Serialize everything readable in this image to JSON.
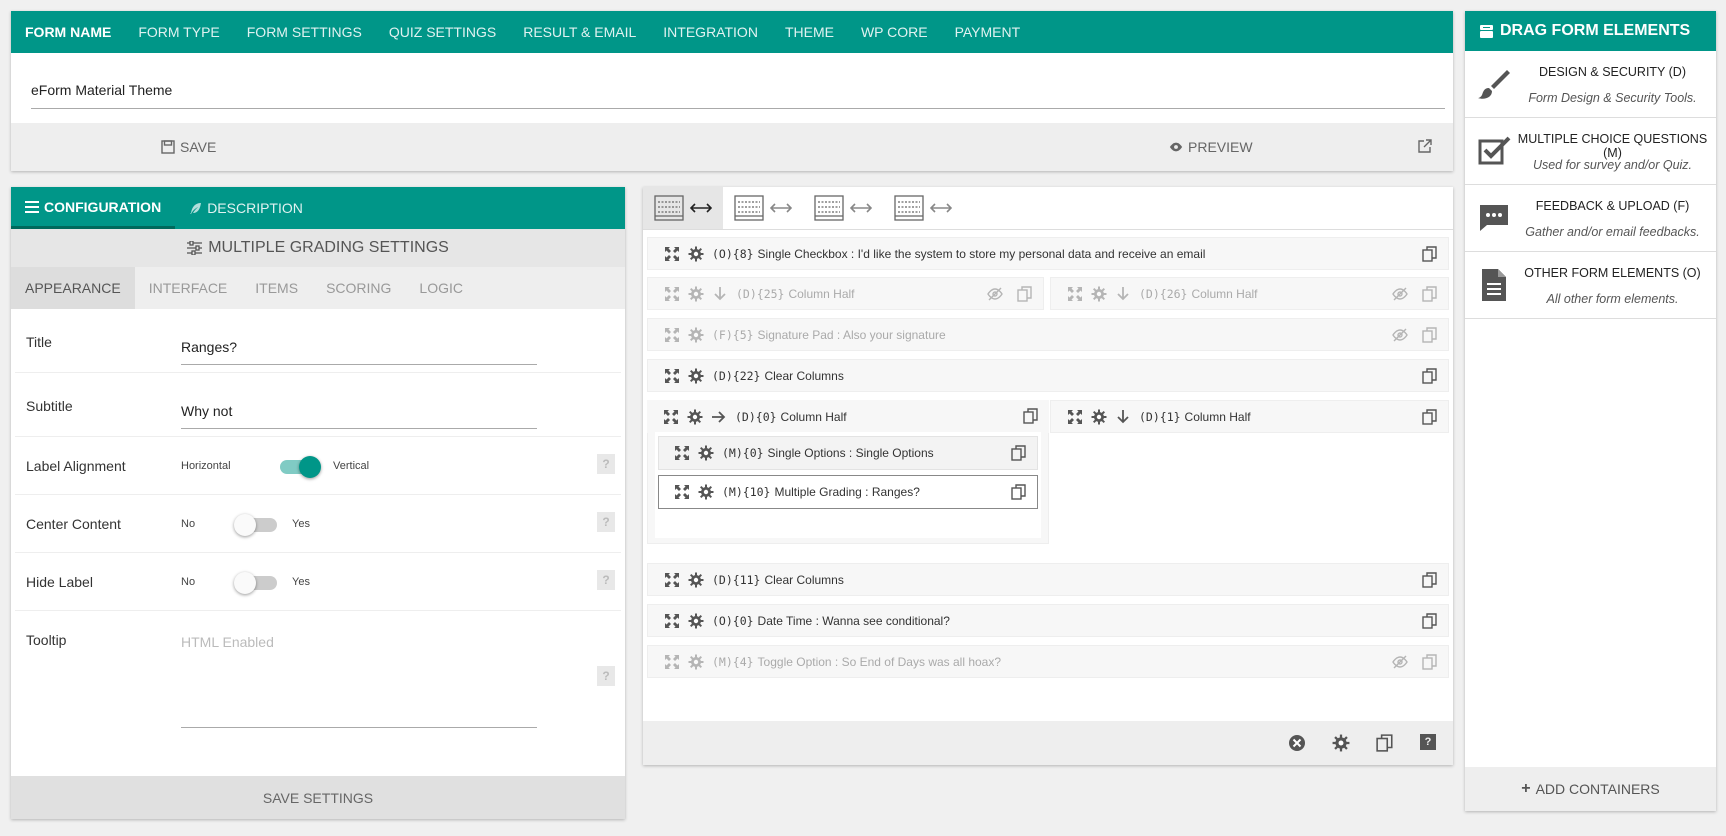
{
  "header": {
    "tabs": [
      "FORM NAME",
      "FORM TYPE",
      "FORM SETTINGS",
      "QUIZ SETTINGS",
      "RESULT & EMAIL",
      "INTEGRATION",
      "THEME",
      "WP CORE",
      "PAYMENT"
    ],
    "form_name_value": "eForm Material Theme",
    "save_label": "SAVE",
    "preview_label": "PREVIEW"
  },
  "right_panel": {
    "title": "DRAG FORM ELEMENTS",
    "items": [
      {
        "title": "DESIGN & SECURITY (D)",
        "desc": "Form Design & Security Tools.",
        "icon": "paint-brush-icon"
      },
      {
        "title": "MULTIPLE CHOICE QUESTIONS (M)",
        "desc": "Used for survey and/or Quiz.",
        "icon": "checkbox-icon"
      },
      {
        "title": "FEEDBACK & UPLOAD (F)",
        "desc": "Gather and/or email feedbacks.",
        "icon": "comment-icon"
      },
      {
        "title": "OTHER FORM ELEMENTS (O)",
        "desc": "All other form elements.",
        "icon": "document-icon"
      }
    ],
    "add_containers": "ADD CONTAINERS"
  },
  "config": {
    "tabs": [
      "CONFIGURATION",
      "DESCRIPTION"
    ],
    "section_title": "MULTIPLE GRADING SETTINGS",
    "subtabs": [
      "APPEARANCE",
      "INTERFACE",
      "ITEMS",
      "SCORING",
      "LOGIC"
    ],
    "fields": {
      "title_label": "Title",
      "title_value": "Ranges?",
      "subtitle_label": "Subtitle",
      "subtitle_value": "Why not",
      "label_alignment": "Label Alignment",
      "horizontal": "Horizontal",
      "vertical": "Vertical",
      "center_content": "Center Content",
      "hide_label": "Hide Label",
      "no": "No",
      "yes": "Yes",
      "tooltip_label": "Tooltip",
      "tooltip_placeholder": "HTML Enabled"
    },
    "save_settings": "SAVE SETTINGS"
  },
  "builder": {
    "elements": {
      "e1": {
        "code": "(O){8}",
        "text": "Single Checkbox : I'd like the system to store my personal data and receive an email"
      },
      "e2": {
        "code": "(D){25}",
        "text": "Column Half"
      },
      "e3": {
        "code": "(D){26}",
        "text": "Column Half"
      },
      "e4": {
        "code": "(F){5}",
        "text": "Signature Pad : Also your signature"
      },
      "e5": {
        "code": "(D){22}",
        "text": "Clear Columns"
      },
      "e6": {
        "code": "(D){0}",
        "text": "Column Half"
      },
      "e7": {
        "code": "(D){1}",
        "text": "Column Half"
      },
      "e8": {
        "code": "(M){0}",
        "text": "Single Options : Single Options"
      },
      "e9": {
        "code": "(M){10}",
        "text": "Multiple Grading : Ranges?"
      },
      "e10": {
        "code": "(D){11}",
        "text": "Clear Columns"
      },
      "e11": {
        "code": "(O){0}",
        "text": "Date Time : Wanna see conditional?"
      },
      "e12": {
        "code": "(M){4}",
        "text": "Toggle Option : So End of Days was all hoax?"
      }
    }
  },
  "colors": {
    "accent": "#009688",
    "accent_dark": "#00695c",
    "toggle_track": "#80cbc4"
  }
}
